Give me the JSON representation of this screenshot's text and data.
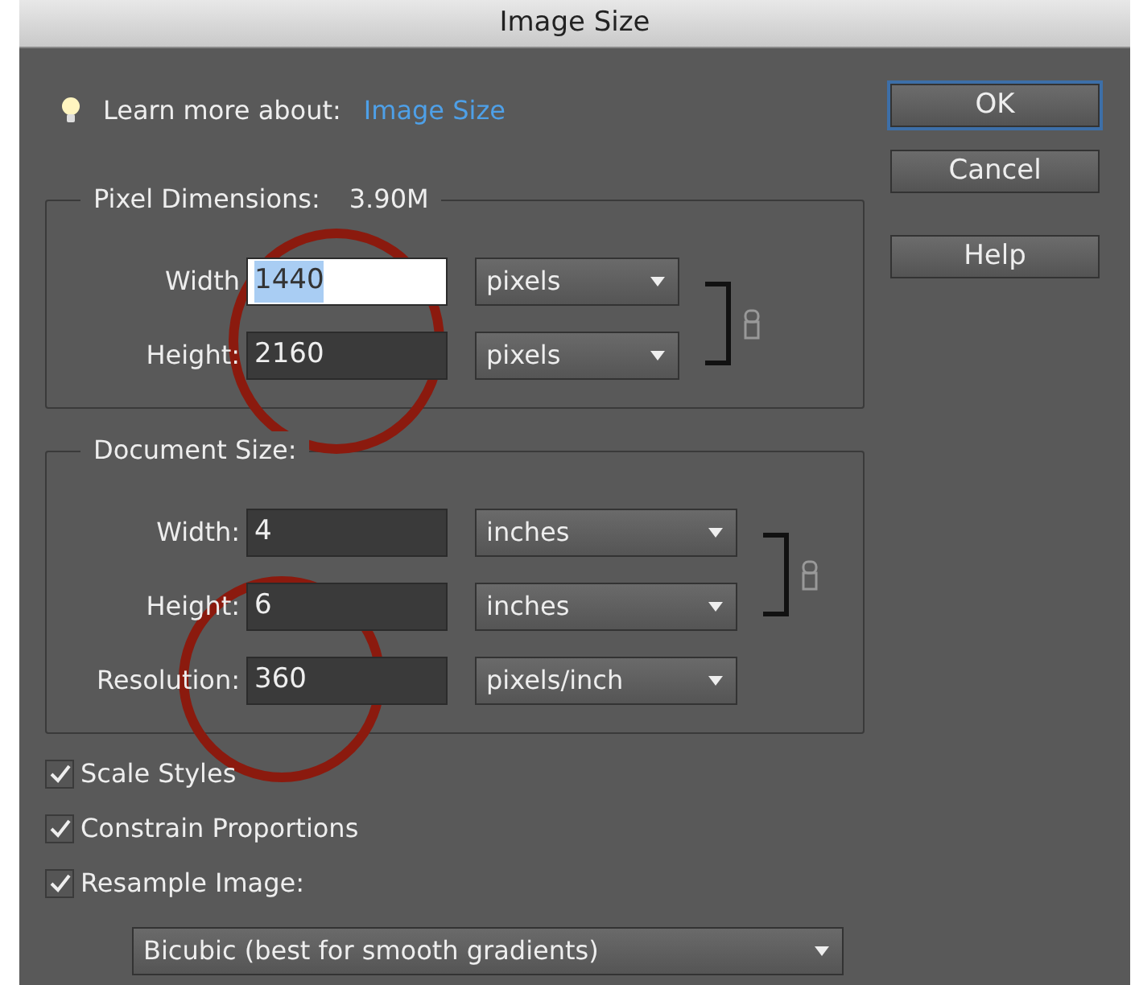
{
  "window": {
    "title": "Image Size"
  },
  "learn_more": {
    "label": "Learn more about:",
    "link": "Image Size"
  },
  "buttons": [
    {
      "label": "OK",
      "default": true
    },
    {
      "label": "Cancel",
      "default": false
    },
    {
      "label": "Help",
      "default": false
    }
  ],
  "pixel_dimensions": {
    "title": "Pixel Dimensions:",
    "size": "3.90M",
    "linked": true,
    "circled": true,
    "fields": [
      {
        "label": "Width",
        "value": "1440",
        "selected": true,
        "unit": "pixels"
      },
      {
        "label": "Height:",
        "value": "2160",
        "selected": false,
        "unit": "pixels"
      }
    ]
  },
  "document_size": {
    "title": "Document Size:",
    "linked": true,
    "fields": [
      {
        "label": "Width:",
        "value": "4",
        "selected": false,
        "unit": "inches"
      },
      {
        "label": "Height:",
        "value": "6",
        "selected": false,
        "unit": "inches"
      },
      {
        "label": "Resolution:",
        "value": "360",
        "selected": false,
        "unit": "pixels/inch",
        "circled": true
      }
    ]
  },
  "checkboxes": [
    {
      "label": "Scale Styles",
      "checked": true
    },
    {
      "label": "Constrain Proportions",
      "checked": true
    },
    {
      "label": "Resample Image:",
      "checked": true
    }
  ],
  "resample_method": "Bicubic (best for smooth gradients)"
}
